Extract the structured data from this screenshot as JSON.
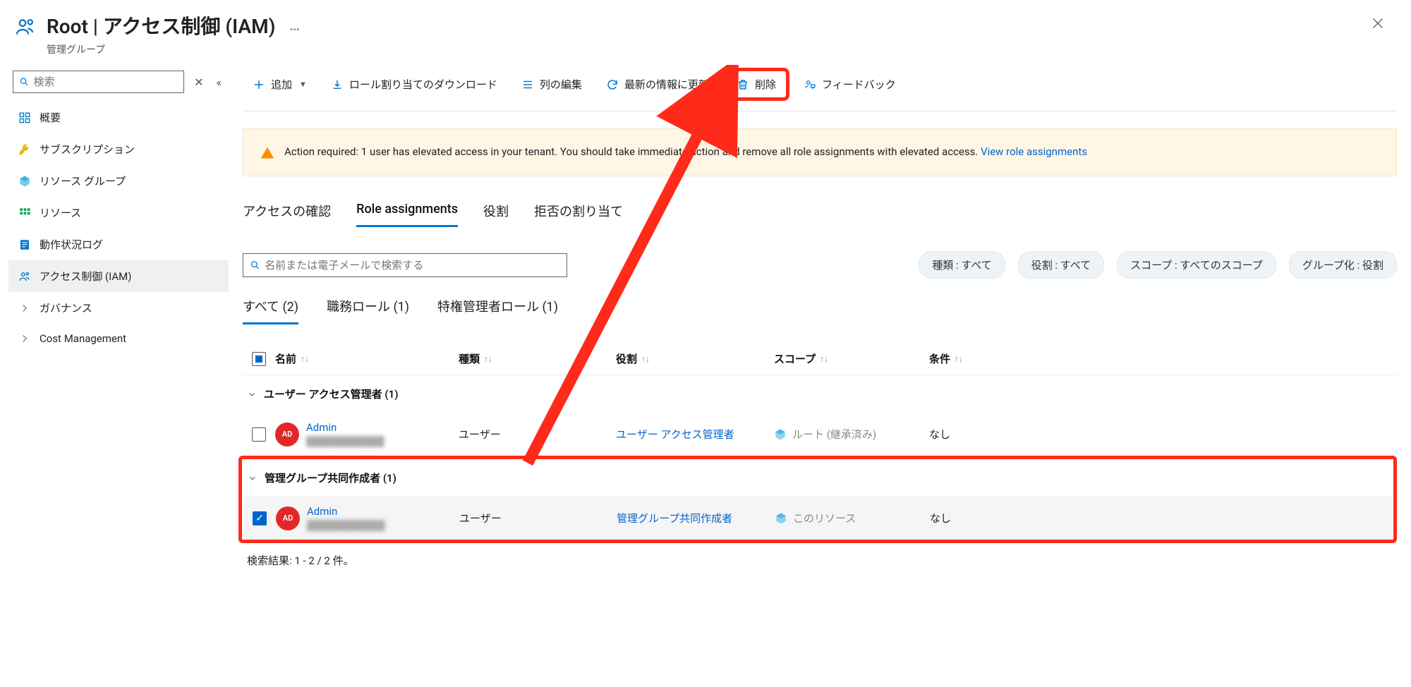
{
  "header": {
    "title": "Root | アクセス制御 (IAM)",
    "subtitle": "管理グループ",
    "ellipsis": "…"
  },
  "sidebar": {
    "search_placeholder": "検索",
    "items": [
      {
        "label": "概要",
        "icon": "overview"
      },
      {
        "label": "サブスクリプション",
        "icon": "key"
      },
      {
        "label": "リソース グループ",
        "icon": "resource-group"
      },
      {
        "label": "リソース",
        "icon": "grid"
      },
      {
        "label": "動作状況ログ",
        "icon": "log"
      },
      {
        "label": "アクセス制御 (IAM)",
        "icon": "users",
        "active": true
      },
      {
        "label": "ガバナンス",
        "icon": "chevron"
      },
      {
        "label": "Cost Management",
        "icon": "chevron"
      }
    ]
  },
  "toolbar": {
    "add": "追加",
    "download": "ロール割り当てのダウンロード",
    "edit_columns": "列の編集",
    "refresh": "最新の情報に更新",
    "delete": "削除",
    "feedback": "フィードバック"
  },
  "alert": {
    "text_prefix": "Action required: 1 user has elevated access in your tenant. You should take immediate action and remove all role assignments with elevated access. ",
    "link": "View role assignments"
  },
  "tabs_primary": [
    {
      "label": "アクセスの確認"
    },
    {
      "label": "Role assignments",
      "active": true
    },
    {
      "label": "役割"
    },
    {
      "label": "拒否の割り当て"
    }
  ],
  "filters": {
    "search_placeholder": "名前または電子メールで検索する",
    "pills": [
      "種類 : すべて",
      "役割 : すべて",
      "スコープ : すべてのスコープ",
      "グループ化 : 役割"
    ]
  },
  "tabs_secondary": [
    {
      "label": "すべて (2)",
      "active": true
    },
    {
      "label": "職務ロール (1)"
    },
    {
      "label": "特権管理者ロール (1)"
    }
  ],
  "columns": {
    "name": "名前",
    "type": "種類",
    "role": "役割",
    "scope": "スコープ",
    "condition": "条件"
  },
  "groups": [
    {
      "title": "ユーザー アクセス管理者 (1)",
      "rows": [
        {
          "avatar": "AD",
          "name": "Admin",
          "type": "ユーザー",
          "role": "ユーザー アクセス管理者",
          "scope": "ルート (継承済み)",
          "condition": "なし",
          "checked": false
        }
      ]
    },
    {
      "title": "管理グループ共同作成者 (1)",
      "highlighted": true,
      "rows": [
        {
          "avatar": "AD",
          "name": "Admin",
          "type": "ユーザー",
          "role": "管理グループ共同作成者",
          "scope": "このリソース",
          "condition": "なし",
          "checked": true
        }
      ]
    }
  ],
  "result_text": "検索結果: 1 - 2 / 2 件。"
}
